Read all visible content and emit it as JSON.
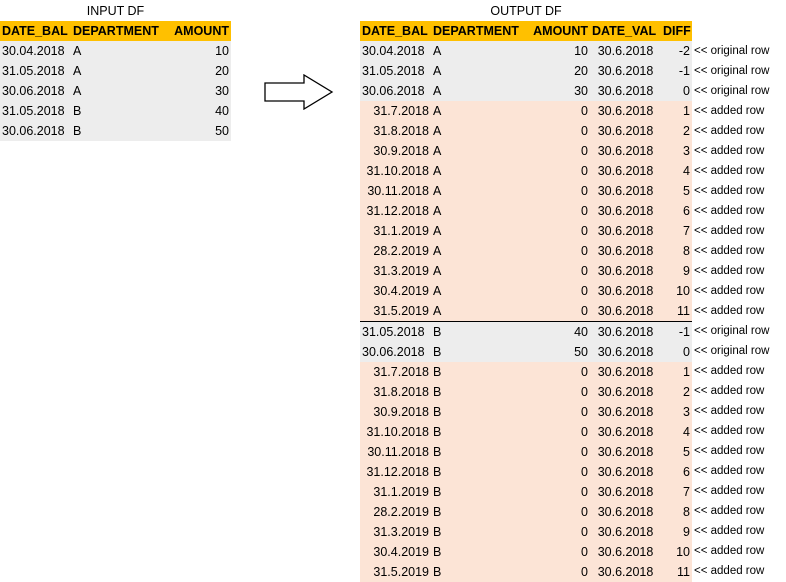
{
  "input_df": {
    "caption": "INPUT DF",
    "headers": [
      "DATE_BAL",
      "DEPARTMENT",
      "AMOUNT"
    ],
    "rows": [
      [
        "30.04.2018",
        "A",
        "10"
      ],
      [
        "31.05.2018",
        "A",
        "20"
      ],
      [
        "30.06.2018",
        "A",
        "30"
      ],
      [
        "31.05.2018",
        "B",
        "40"
      ],
      [
        "30.06.2018",
        "B",
        "50"
      ]
    ]
  },
  "output_df": {
    "caption": "OUTPUT DF",
    "headers": [
      "DATE_BAL",
      "DEPARTMENT",
      "AMOUNT",
      "DATE_VAL",
      "DIFF"
    ],
    "rows": [
      {
        "cells": [
          "30.04.2018",
          "A",
          "10",
          "30.6.2018",
          "-2"
        ],
        "kind": "original",
        "note": "<< original row"
      },
      {
        "cells": [
          "31.05.2018",
          "A",
          "20",
          "30.6.2018",
          "-1"
        ],
        "kind": "original",
        "note": "<< original row"
      },
      {
        "cells": [
          "30.06.2018",
          "A",
          "30",
          "30.6.2018",
          "0"
        ],
        "kind": "original",
        "note": "<< original row"
      },
      {
        "cells": [
          "31.7.2018",
          "A",
          "0",
          "30.6.2018",
          "1"
        ],
        "kind": "added",
        "note": "<< added row"
      },
      {
        "cells": [
          "31.8.2018",
          "A",
          "0",
          "30.6.2018",
          "2"
        ],
        "kind": "added",
        "note": "<< added row"
      },
      {
        "cells": [
          "30.9.2018",
          "A",
          "0",
          "30.6.2018",
          "3"
        ],
        "kind": "added",
        "note": "<< added row"
      },
      {
        "cells": [
          "31.10.2018",
          "A",
          "0",
          "30.6.2018",
          "4"
        ],
        "kind": "added",
        "note": "<< added row"
      },
      {
        "cells": [
          "30.11.2018",
          "A",
          "0",
          "30.6.2018",
          "5"
        ],
        "kind": "added",
        "note": "<< added row"
      },
      {
        "cells": [
          "31.12.2018",
          "A",
          "0",
          "30.6.2018",
          "6"
        ],
        "kind": "added",
        "note": "<< added row"
      },
      {
        "cells": [
          "31.1.2019",
          "A",
          "0",
          "30.6.2018",
          "7"
        ],
        "kind": "added",
        "note": "<< added row"
      },
      {
        "cells": [
          "28.2.2019",
          "A",
          "0",
          "30.6.2018",
          "8"
        ],
        "kind": "added",
        "note": "<< added row"
      },
      {
        "cells": [
          "31.3.2019",
          "A",
          "0",
          "30.6.2018",
          "9"
        ],
        "kind": "added",
        "note": "<< added row"
      },
      {
        "cells": [
          "30.4.2019",
          "A",
          "0",
          "30.6.2018",
          "10"
        ],
        "kind": "added",
        "note": "<< added row"
      },
      {
        "cells": [
          "31.5.2019",
          "A",
          "0",
          "30.6.2018",
          "11"
        ],
        "kind": "added",
        "note": "<< added row"
      },
      {
        "cells": [
          "31.05.2018",
          "B",
          "40",
          "30.6.2018",
          "-1"
        ],
        "kind": "original",
        "note": "<< original row",
        "separator": true
      },
      {
        "cells": [
          "30.06.2018",
          "B",
          "50",
          "30.6.2018",
          "0"
        ],
        "kind": "original",
        "note": "<< original row"
      },
      {
        "cells": [
          "31.7.2018",
          "B",
          "0",
          "30.6.2018",
          "1"
        ],
        "kind": "added",
        "note": "<< added row"
      },
      {
        "cells": [
          "31.8.2018",
          "B",
          "0",
          "30.6.2018",
          "2"
        ],
        "kind": "added",
        "note": "<< added row"
      },
      {
        "cells": [
          "30.9.2018",
          "B",
          "0",
          "30.6.2018",
          "3"
        ],
        "kind": "added",
        "note": "<< added row"
      },
      {
        "cells": [
          "31.10.2018",
          "B",
          "0",
          "30.6.2018",
          "4"
        ],
        "kind": "added",
        "note": "<< added row"
      },
      {
        "cells": [
          "30.11.2018",
          "B",
          "0",
          "30.6.2018",
          "5"
        ],
        "kind": "added",
        "note": "<< added row"
      },
      {
        "cells": [
          "31.12.2018",
          "B",
          "0",
          "30.6.2018",
          "6"
        ],
        "kind": "added",
        "note": "<< added row"
      },
      {
        "cells": [
          "31.1.2019",
          "B",
          "0",
          "30.6.2018",
          "7"
        ],
        "kind": "added",
        "note": "<< added row"
      },
      {
        "cells": [
          "28.2.2019",
          "B",
          "0",
          "30.6.2018",
          "8"
        ],
        "kind": "added",
        "note": "<< added row"
      },
      {
        "cells": [
          "31.3.2019",
          "B",
          "0",
          "30.6.2018",
          "9"
        ],
        "kind": "added",
        "note": "<< added row"
      },
      {
        "cells": [
          "30.4.2019",
          "B",
          "0",
          "30.6.2018",
          "10"
        ],
        "kind": "added",
        "note": "<< added row"
      },
      {
        "cells": [
          "31.5.2019",
          "B",
          "0",
          "30.6.2018",
          "11"
        ],
        "kind": "added",
        "note": "<< added row"
      }
    ]
  },
  "arrow_icon": "right-arrow-icon",
  "colors": {
    "header": "#ffc000",
    "original_row": "#ededed",
    "added_row": "#fce4d6"
  }
}
